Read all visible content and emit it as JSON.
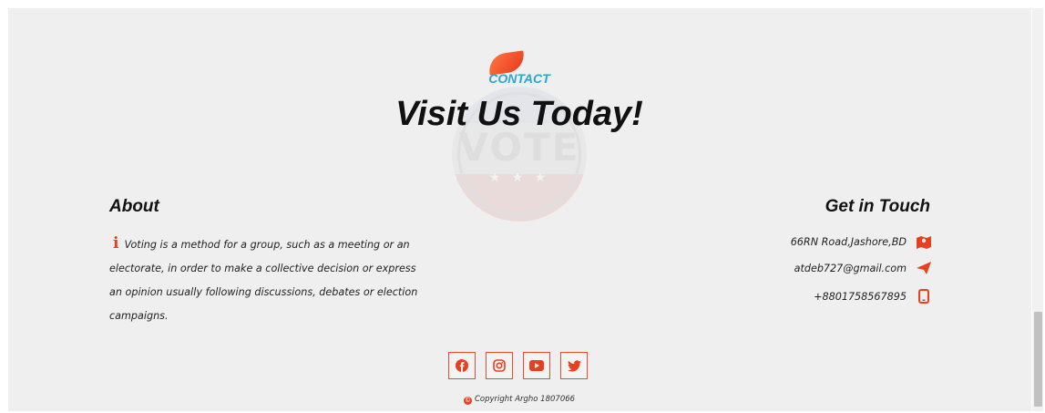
{
  "section": {
    "label": "CONTACT",
    "title": "Visit Us Today!",
    "watermark_word": "VOTE",
    "watermark_stars": "★ ★ ★"
  },
  "about": {
    "heading": "About",
    "icon": "info-icon",
    "text": "Voting is a method for a group, such as a meeting or an electorate, in order to make a collective decision or express an opinion usually following discussions, debates or election campaigns."
  },
  "contact": {
    "heading": "Get in Touch",
    "items": [
      {
        "text": "66RN Road,Jashore,BD",
        "icon": "map-icon"
      },
      {
        "text": "atdeb727@gmail.com",
        "icon": "send-icon"
      },
      {
        "text": "+8801758567895",
        "icon": "phone-icon"
      }
    ]
  },
  "socials": [
    "facebook-icon",
    "instagram-icon",
    "youtube-icon",
    "twitter-icon"
  ],
  "copyright": {
    "icon_glyph": "©",
    "text": "Copyright Argho 1807066"
  },
  "colors": {
    "accent": "#e8401e",
    "contact_label": "#2aa6d6",
    "background": "#efefef"
  }
}
